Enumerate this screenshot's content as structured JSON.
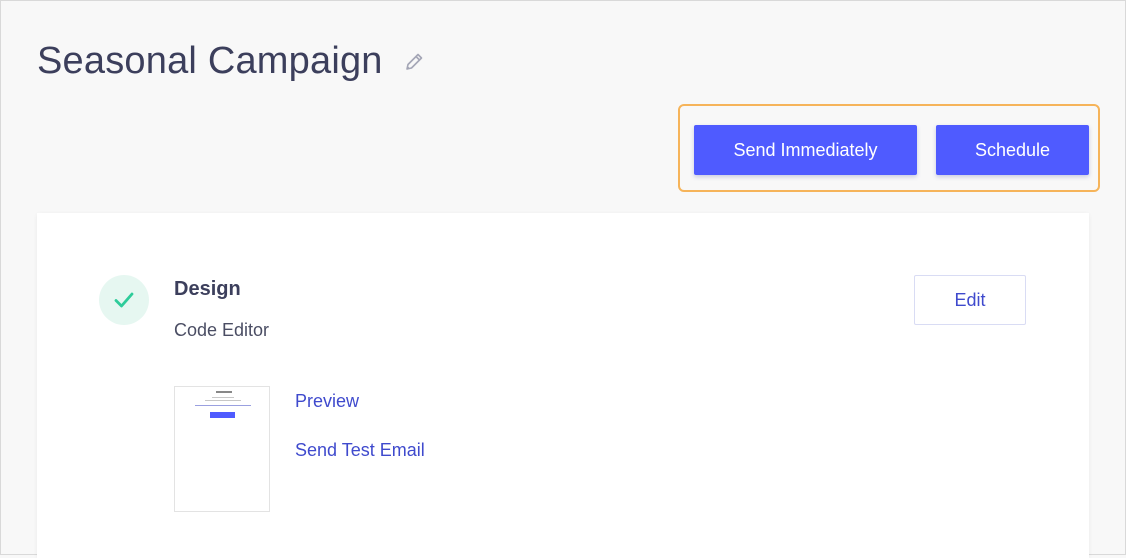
{
  "campaign": {
    "title": "Seasonal Campaign",
    "edit_icon": "pencil-icon"
  },
  "actions": {
    "send_immediately_label": "Send Immediately",
    "schedule_label": "Schedule",
    "highlight_color": "#f6b45a",
    "button_color": "#4f5bff"
  },
  "design_step": {
    "status_icon": "check-icon",
    "status_color": "#2ecc9a",
    "title": "Design",
    "subtitle": "Code Editor",
    "edit_label": "Edit",
    "preview_label": "Preview",
    "send_test_label": "Send Test Email"
  },
  "colors": {
    "background": "#f8f8f8",
    "title_text": "#3c3f5c",
    "link": "#3f4acd"
  }
}
